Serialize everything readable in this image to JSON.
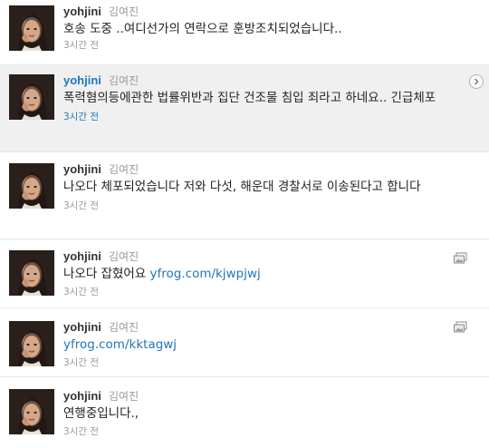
{
  "tweets": [
    {
      "screen_name": "yohjini",
      "full_name": "김여진",
      "text": "호송 도중 ..여디선가의 연락으로 훈방조치되었습니다..",
      "time": "3시간 전",
      "icon": "none"
    },
    {
      "screen_name": "yohjini",
      "full_name": "김여진",
      "text": "폭력혐의등에관한 법률위반과 집단 건조물 침입 죄라고 하네요.. 긴급체포",
      "time": "3시간 전",
      "icon": "details-arrow-icon"
    },
    {
      "screen_name": "yohjini",
      "full_name": "김여진",
      "text": "나오다 체포되었습니다 저와 다섯, 해운대 경찰서로 이송된다고 합니다",
      "time": "3시간 전",
      "icon": "none"
    },
    {
      "screen_name": "yohjini",
      "full_name": "김여진",
      "text_prefix": "나오다 잡혔어요 ",
      "link": "yfrog.com/kjwpjwj",
      "time": "3시간 전",
      "icon": "media-icon"
    },
    {
      "screen_name": "yohjini",
      "full_name": "김여진",
      "text_prefix": "",
      "link": "yfrog.com/kktagwj",
      "time": "3시간 전",
      "icon": "media-icon"
    },
    {
      "screen_name": "yohjini",
      "full_name": "김여진",
      "text": "연행중입니다.,",
      "time": "3시간 전",
      "icon": "none"
    }
  ],
  "colors": {
    "link": "#2276bb",
    "meta": "#999999",
    "hover_bg": "#f0f0f0",
    "divider": "#e8e8e8"
  }
}
